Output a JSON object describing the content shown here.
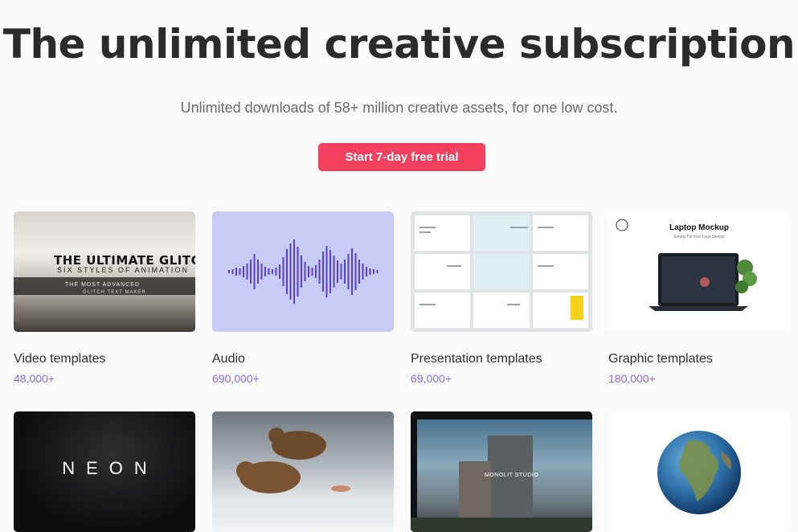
{
  "hero": {
    "title": "The unlimited creative subscription",
    "subtitle": "Unlimited downloads of 58+ million creative assets, for one low cost.",
    "cta_label": "Start 7-day free trial"
  },
  "colors": {
    "accent": "#f2405e",
    "count": "#8b6fdb",
    "audio_bg": "#c8cbf6",
    "wave": "#5b3fd4"
  },
  "cards": [
    {
      "title": "Video templates",
      "count": "48,000+",
      "thumb_text": [
        "THE ULTIMATE GLITCH",
        "SIX STYLES OF ANIMATION",
        "THE MOST ADVANCED",
        "GLITCH TEXT MAKER"
      ]
    },
    {
      "title": "Audio",
      "count": "690,000+",
      "thumb_icon": "waveform-icon"
    },
    {
      "title": "Presentation templates",
      "count": "69,000+",
      "thumb_icon": "slides-grid"
    },
    {
      "title": "Graphic templates",
      "count": "180,000+",
      "thumb_text": [
        "Laptop Mockup",
        "Simply Fill Your Logo Design"
      ]
    }
  ],
  "row2": [
    {
      "thumb_text": "NEON"
    },
    {
      "thumb_icon": "bears-photo"
    },
    {
      "thumb_text": "MONOLIT STUDIO"
    },
    {
      "thumb_icon": "earth-globe"
    }
  ]
}
